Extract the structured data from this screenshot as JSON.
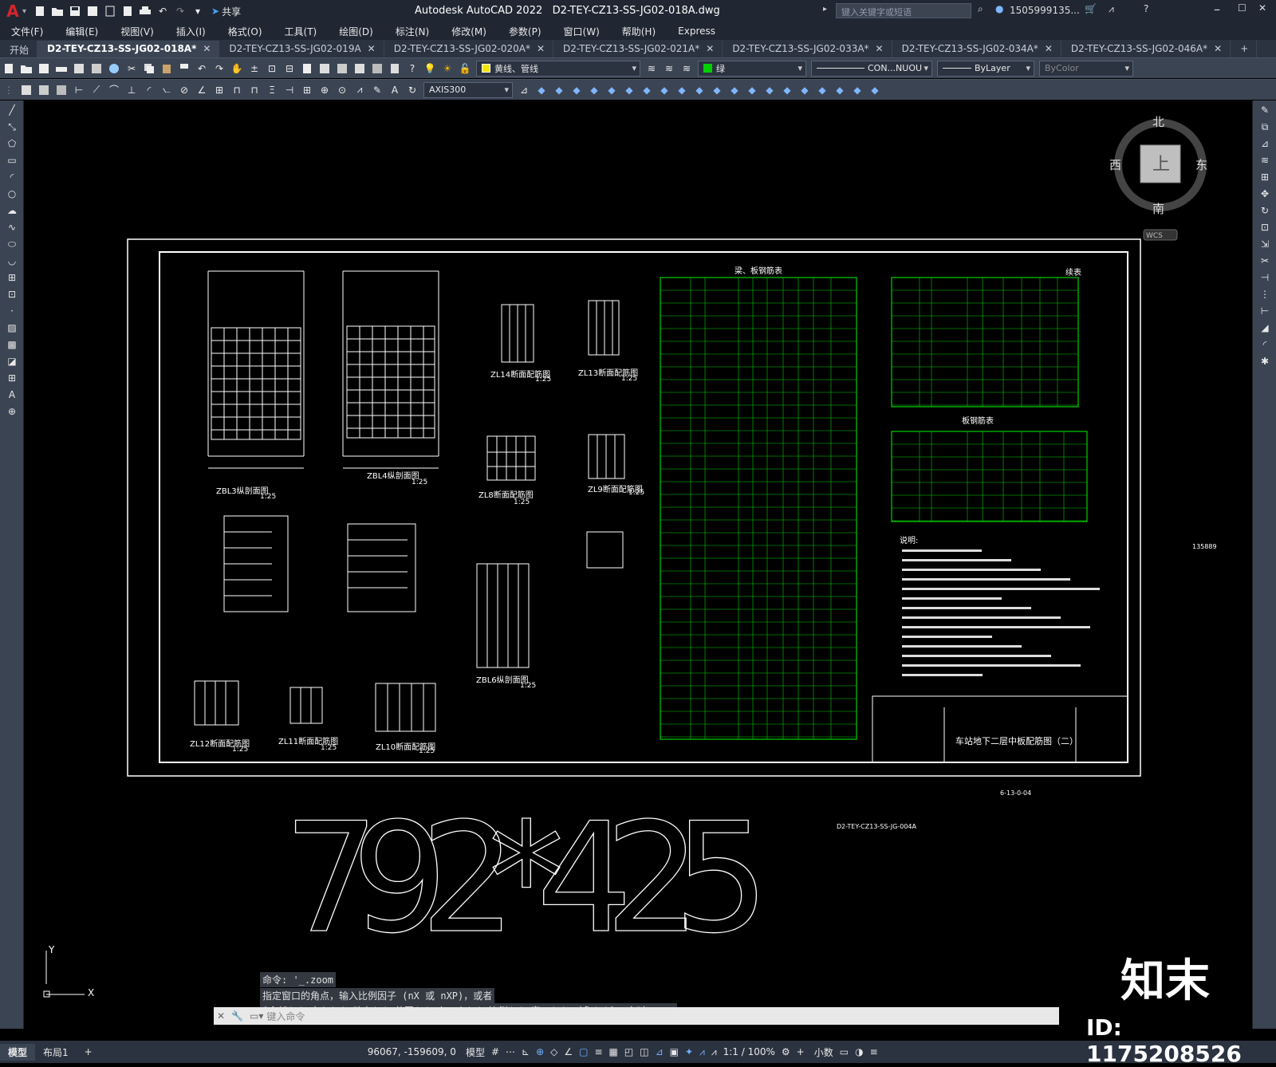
{
  "app": {
    "title": "Autodesk AutoCAD 2022",
    "document": "D2-TEY-CZ13-SS-JG02-018A.dwg",
    "logo": "A",
    "share_label": "共享",
    "search_placeholder": "键入关键字或短语",
    "user": "1505999135...",
    "accent": "#d8242c"
  },
  "menu": [
    "文件(F)",
    "编辑(E)",
    "视图(V)",
    "插入(I)",
    "格式(O)",
    "工具(T)",
    "绘图(D)",
    "标注(N)",
    "修改(M)",
    "参数(P)",
    "窗口(W)",
    "帮助(H)",
    "Express"
  ],
  "tabs": [
    {
      "label": "开始",
      "active": false,
      "closable": false
    },
    {
      "label": "D2-TEY-CZ13-SS-JG02-018A*",
      "active": true,
      "closable": true
    },
    {
      "label": "D2-TEY-CZ13-SS-JG02-019A",
      "active": false,
      "closable": true
    },
    {
      "label": "D2-TEY-CZ13-SS-JG02-020A*",
      "active": false,
      "closable": true
    },
    {
      "label": "D2-TEY-CZ13-SS-JG02-021A*",
      "active": false,
      "closable": true
    },
    {
      "label": "D2-TEY-CZ13-SS-JG02-033A*",
      "active": false,
      "closable": true
    },
    {
      "label": "D2-TEY-CZ13-SS-JG02-034A*",
      "active": false,
      "closable": true
    },
    {
      "label": "D2-TEY-CZ13-SS-JG02-046A*",
      "active": false,
      "closable": true
    }
  ],
  "properties": {
    "layer": "黄线、管线",
    "layer_color": "#f4e400",
    "color": "绿",
    "color_swatch": "#00d000",
    "linetype": "CON...NUOU",
    "lineweight": "ByLayer",
    "plotstyle": "ByColor",
    "dimstyle": "AXIS300"
  },
  "viewcube": {
    "north": "北",
    "south": "南",
    "east": "东",
    "west": "西",
    "top": "上",
    "wcs": "WCS"
  },
  "drawing": {
    "main_text": "792*425",
    "sheet_title": "车站地下二层中板配筋图（二）",
    "ref_code": "D2-TEY-CZ13-SS-JG-004A",
    "sheet_no": "6-13-0-04",
    "table1_title": "梁、板钢筋表",
    "table2_title": "续表",
    "table3_title": "板钢筋表",
    "notes_title": "说明:",
    "beams": [
      "ZBL3纵剖面图",
      "ZBL4纵剖面图",
      "ZL14断面配筋图",
      "ZL13断面配筋图",
      "ZL8断面配筋图",
      "ZL9断面配筋图",
      "ZBL6纵剖面图",
      "ZL12断面配筋图",
      "ZL11断面配筋图",
      "ZL10断面配筋图"
    ],
    "scale": "1:25",
    "coord_text": "135889"
  },
  "command": {
    "history": [
      "命令: '_.zoom",
      "指定窗口的角点，输入比例因子 (nX 或 nXP)，或者",
      "[全部(A)/中心(C)/动态(D)/范围(E)/上一个(P)/比例(S)/窗口(W)/对象(O)] <实时>: _e"
    ],
    "placeholder": "键入命令"
  },
  "status": {
    "layouts": [
      "模型",
      "布局1"
    ],
    "coords": "96067, -159609, 0",
    "space": "模型",
    "scale": "1:1 / 100%",
    "units": "小数"
  },
  "watermark": {
    "logo": "知末",
    "id": "ID: 1175208526"
  }
}
